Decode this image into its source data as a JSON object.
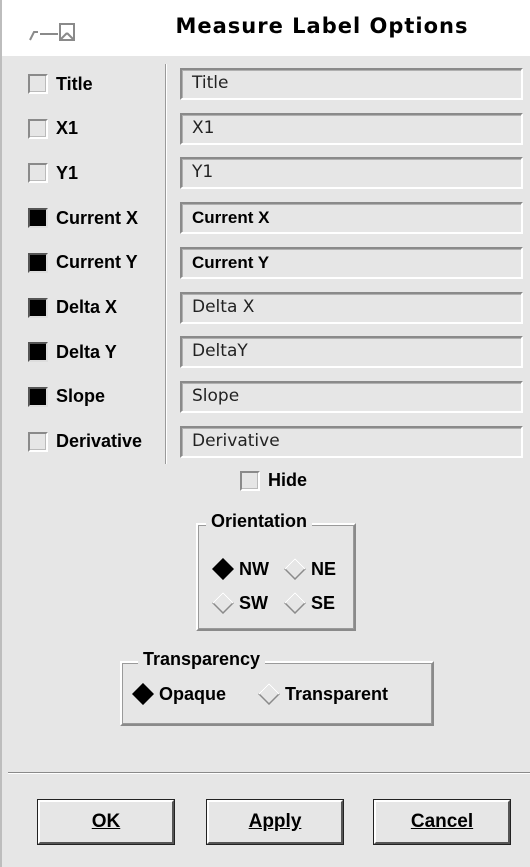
{
  "window": {
    "title": "Measure Label Options",
    "icon": "window-menu-icon"
  },
  "labels": [
    {
      "checkbox_label": "Title",
      "checked": false,
      "field_value": "Title",
      "field_bold": false
    },
    {
      "checkbox_label": "X1",
      "checked": false,
      "field_value": "X1",
      "field_bold": false
    },
    {
      "checkbox_label": "Y1",
      "checked": false,
      "field_value": "Y1",
      "field_bold": false
    },
    {
      "checkbox_label": "Current X",
      "checked": true,
      "field_value": "Current X",
      "field_bold": true
    },
    {
      "checkbox_label": "Current Y",
      "checked": true,
      "field_value": "Current Y",
      "field_bold": true
    },
    {
      "checkbox_label": "Delta X",
      "checked": true,
      "field_value": "Delta X",
      "field_bold": false
    },
    {
      "checkbox_label": "Delta Y",
      "checked": true,
      "field_value": "DeltaY",
      "field_bold": false
    },
    {
      "checkbox_label": "Slope",
      "checked": true,
      "field_value": "Slope",
      "field_bold": false
    },
    {
      "checkbox_label": "Derivative",
      "checked": false,
      "field_value": "Derivative",
      "field_bold": false
    }
  ],
  "hide": {
    "label": "Hide",
    "checked": false
  },
  "orientation": {
    "title": "Orientation",
    "options": [
      "NW",
      "NE",
      "SW",
      "SE"
    ],
    "selected": "NW"
  },
  "transparency": {
    "title": "Transparency",
    "options": [
      "Opaque",
      "Transparent"
    ],
    "selected": "Opaque"
  },
  "buttons": {
    "ok": "OK",
    "apply": "Apply",
    "cancel": "Cancel"
  }
}
